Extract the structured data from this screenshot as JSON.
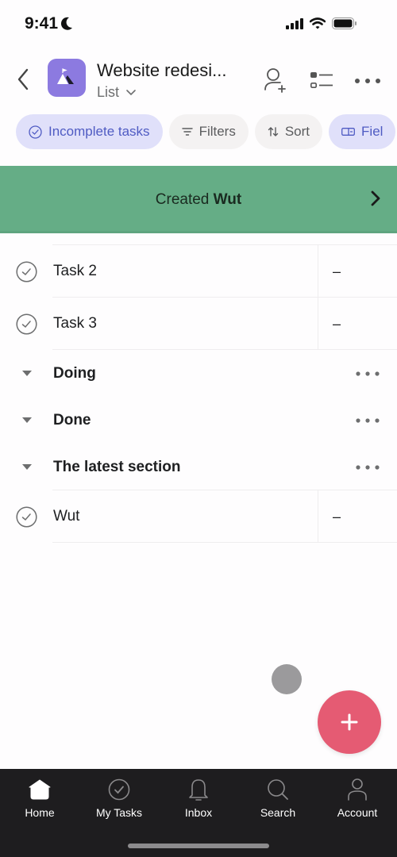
{
  "status_bar": {
    "time": "9:41",
    "focus_icon": "moon-icon",
    "icons": [
      "cellular-signal-icon",
      "wifi-icon",
      "battery-icon"
    ]
  },
  "header": {
    "back_icon": "chevron-left-icon",
    "project_icon": "mountain-flag-icon",
    "project_icon_color": "#8c7ae0",
    "title": "Website redesi...",
    "view_label": "List",
    "actions": [
      "add-member-icon",
      "customize-view-icon",
      "more-icon"
    ]
  },
  "chips": [
    {
      "label": "Incomplete tasks",
      "icon": "check-circle-icon",
      "active": true
    },
    {
      "label": "Filters",
      "icon": "filter-icon",
      "active": false
    },
    {
      "label": "Sort",
      "icon": "sort-icon",
      "active": false
    },
    {
      "label": "Fiel",
      "icon": "fields-icon",
      "active": true
    }
  ],
  "banner": {
    "prefix": "Created",
    "highlight": "Wut",
    "color": "#65ad86"
  },
  "list": {
    "tasks_top": [
      {
        "name": "Task 2",
        "field": "–"
      },
      {
        "name": "Task 3",
        "field": "–"
      }
    ],
    "sections": [
      {
        "name": "Doing"
      },
      {
        "name": "Done"
      },
      {
        "name": "The latest section"
      }
    ],
    "tasks_bottom": [
      {
        "name": "Wut",
        "field": "–"
      }
    ]
  },
  "fab": {
    "icon": "plus-icon",
    "color": "#e55b73"
  },
  "tabbar": {
    "items": [
      {
        "label": "Home",
        "icon": "home-icon",
        "active": true
      },
      {
        "label": "My Tasks",
        "icon": "check-circle-icon",
        "active": false
      },
      {
        "label": "Inbox",
        "icon": "bell-icon",
        "active": false
      },
      {
        "label": "Search",
        "icon": "search-icon",
        "active": false
      },
      {
        "label": "Account",
        "icon": "person-icon",
        "active": false
      }
    ]
  }
}
